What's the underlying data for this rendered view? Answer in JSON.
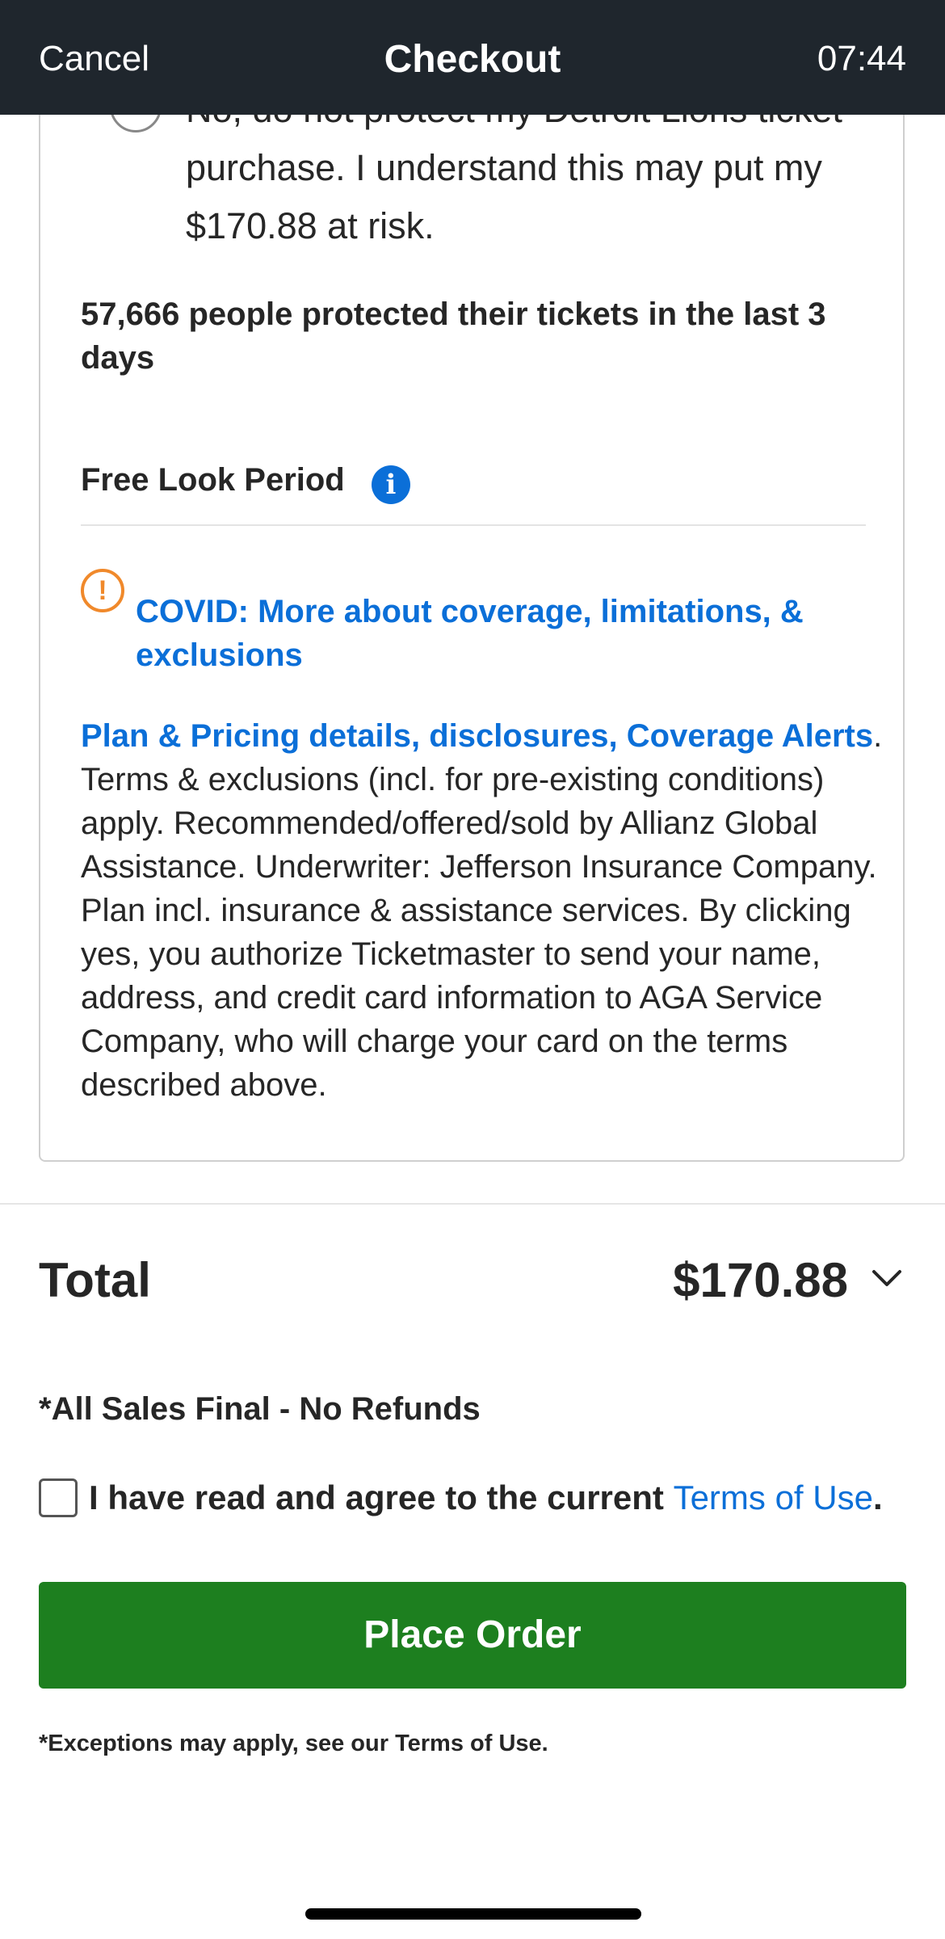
{
  "navbar": {
    "cancel_label": "Cancel",
    "title": "Checkout",
    "time": "07:44"
  },
  "protection": {
    "option_text": "No, do not protect my Detroit Lions ticket purchase. I understand this may put my $170.88 at risk.",
    "stat": "57,666 people protected their tickets in the last 3 days",
    "free_look_label": "Free Look Period",
    "info_icon": "i",
    "warning_icon": "!",
    "covid_link": "COVID: More about coverage, limitations, & exclusions",
    "plan_link": "Plan & Pricing details, disclosures, Coverage Alerts",
    "disclosure_text": ". Terms & exclusions (incl. for pre-existing conditions) apply. Recommended/offered/sold by Allianz Global Assistance. Underwriter: Jefferson Insurance Company. Plan incl. insurance & assistance services. By clicking yes, you authorize Ticketmaster to send your name, address, and credit card information to AGA Service Company, who will charge your card on the terms described above."
  },
  "total": {
    "label": "Total",
    "amount": "$170.88"
  },
  "terms": {
    "sales_final": "*All Sales Final - No Refunds",
    "agree_prefix": "I have read and agree to the current ",
    "terms_link": "Terms of Use",
    "agree_suffix": "."
  },
  "place_order_label": "Place Order",
  "footnote": "*Exceptions may apply, see our Terms of Use.",
  "colors": {
    "navbar_bg": "#1f262d",
    "link_blue": "#0b6fd8",
    "warning_orange": "#f0892b",
    "button_green": "#1d7f1f"
  },
  "icons": [
    "info-icon",
    "warning-icon",
    "chevron-down-icon",
    "checkbox-icon",
    "radio-icon"
  ]
}
